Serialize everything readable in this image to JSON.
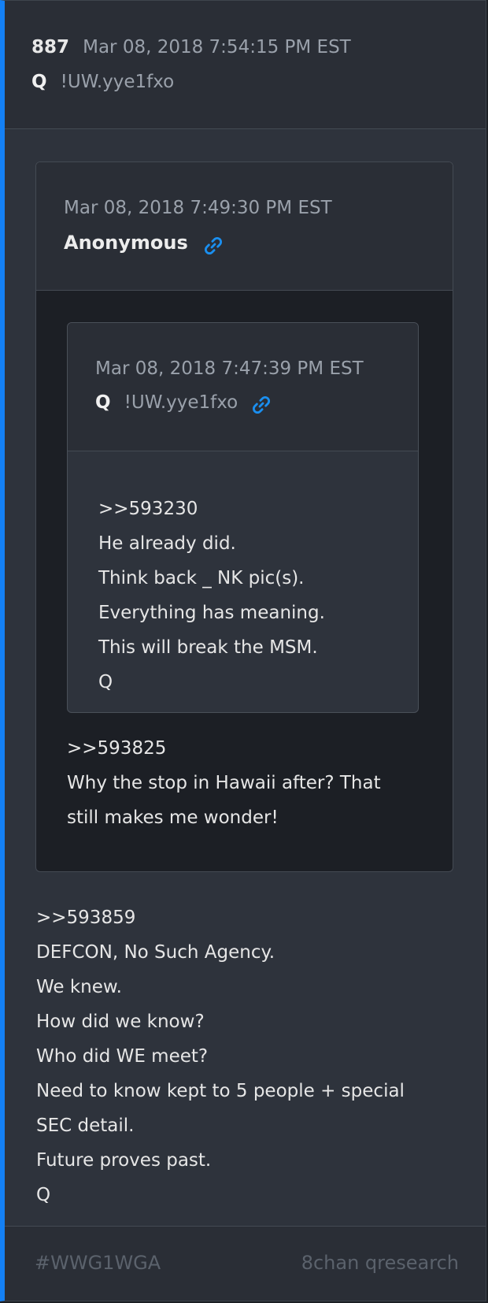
{
  "post": {
    "number": "887",
    "date": "Mar 08, 2018 7:54:15 PM EST",
    "author": "Q",
    "tripcode": "!UW.yye1fxo",
    "lines": [
      ">>593859",
      "DEFCON, No Such Agency.",
      "We knew.",
      "How did we know?",
      "Who did WE meet?",
      "Need to know kept to 5 people + special",
      "SEC detail.",
      "Future proves past.",
      "Q"
    ]
  },
  "quote1": {
    "date": "Mar 08, 2018 7:49:30 PM EST",
    "author": "Anonymous",
    "lines": [
      ">>593825",
      "Why the stop in Hawaii after? That",
      "still makes me wonder!"
    ]
  },
  "quote2": {
    "date": "Mar 08, 2018 7:47:39 PM EST",
    "author": "Q",
    "tripcode": "!UW.yye1fxo",
    "lines": [
      ">>593230",
      "He already did.",
      "Think back _ NK pic(s).",
      "Everything has meaning.",
      "This will break the MSM.",
      "Q"
    ]
  },
  "footer": {
    "hashtag": "#WWG1WGA",
    "source": "8chan qresearch"
  },
  "icons": {
    "link": "link-icon"
  },
  "colors": {
    "accent": "#1480f4",
    "link_icon": "#1a8ff0"
  }
}
